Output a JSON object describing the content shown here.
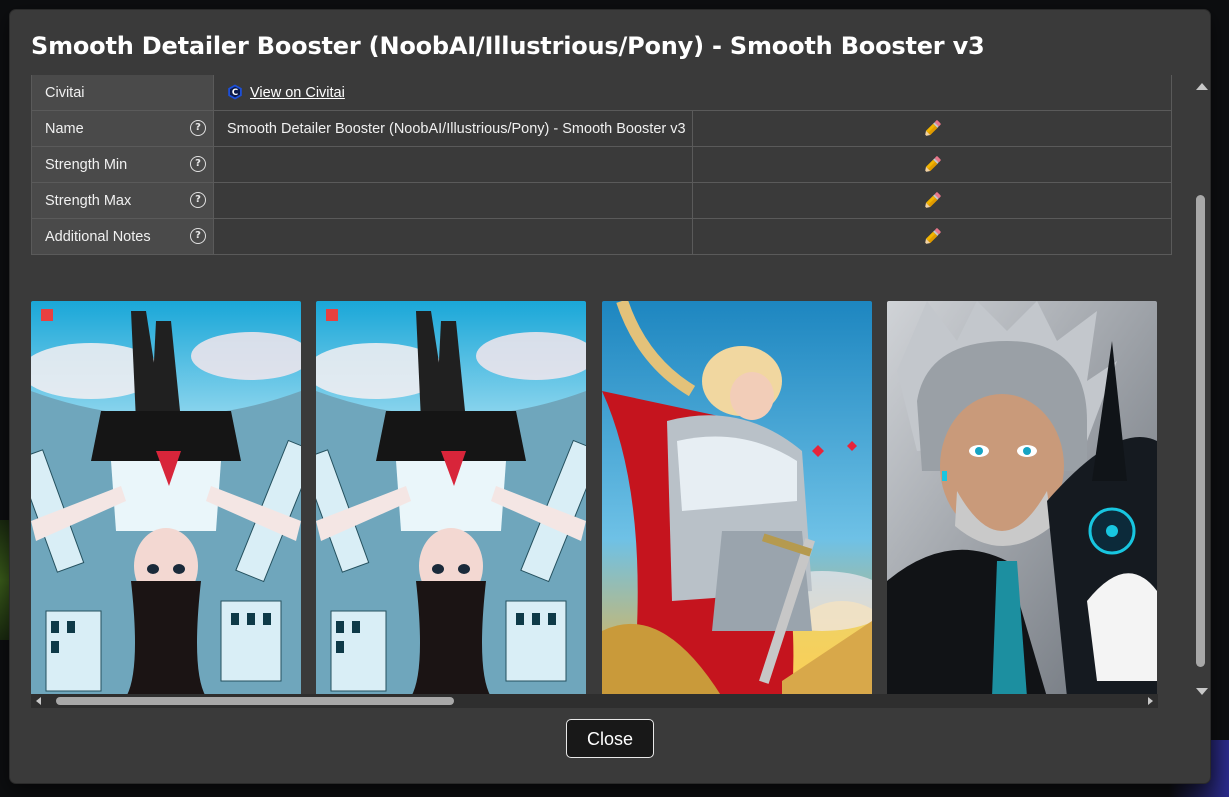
{
  "dialog": {
    "title": "Smooth Detailer Booster (NoobAI/Illustrious/Pony) - Smooth Booster v3",
    "close_label": "Close"
  },
  "info_table": {
    "rows": [
      {
        "key": "Civitai",
        "link_text": "View on Civitai",
        "icon": "civitai-logo-icon"
      },
      {
        "key": "Name",
        "value": "Smooth Detailer Booster (NoobAI/Illustrious/Pony) - Smooth Booster v3",
        "help": "?",
        "editable": true
      },
      {
        "key": "Strength Min",
        "value": "",
        "help": "?",
        "editable": true
      },
      {
        "key": "Strength Max",
        "value": "",
        "help": "?",
        "editable": true
      },
      {
        "key": "Additional Notes",
        "value": "",
        "help": "?",
        "editable": true
      }
    ],
    "edit_icon": "pencil-icon",
    "help_icon": "question-circle-icon"
  },
  "gallery": {
    "images": [
      {
        "subject": "upside-down anime schoolgirl over city"
      },
      {
        "subject": "upside-down anime schoolgirl over city"
      },
      {
        "subject": "blonde knight in silver armor with red cape and sword"
      },
      {
        "subject": "silver-haired man in black suit with robotic figure"
      }
    ]
  },
  "colors": {
    "dialog_bg": "#3a3a3a",
    "key_cell_bg": "#4a4a4a",
    "border": "#5a5a5a",
    "close_button_bg": "#181818"
  }
}
